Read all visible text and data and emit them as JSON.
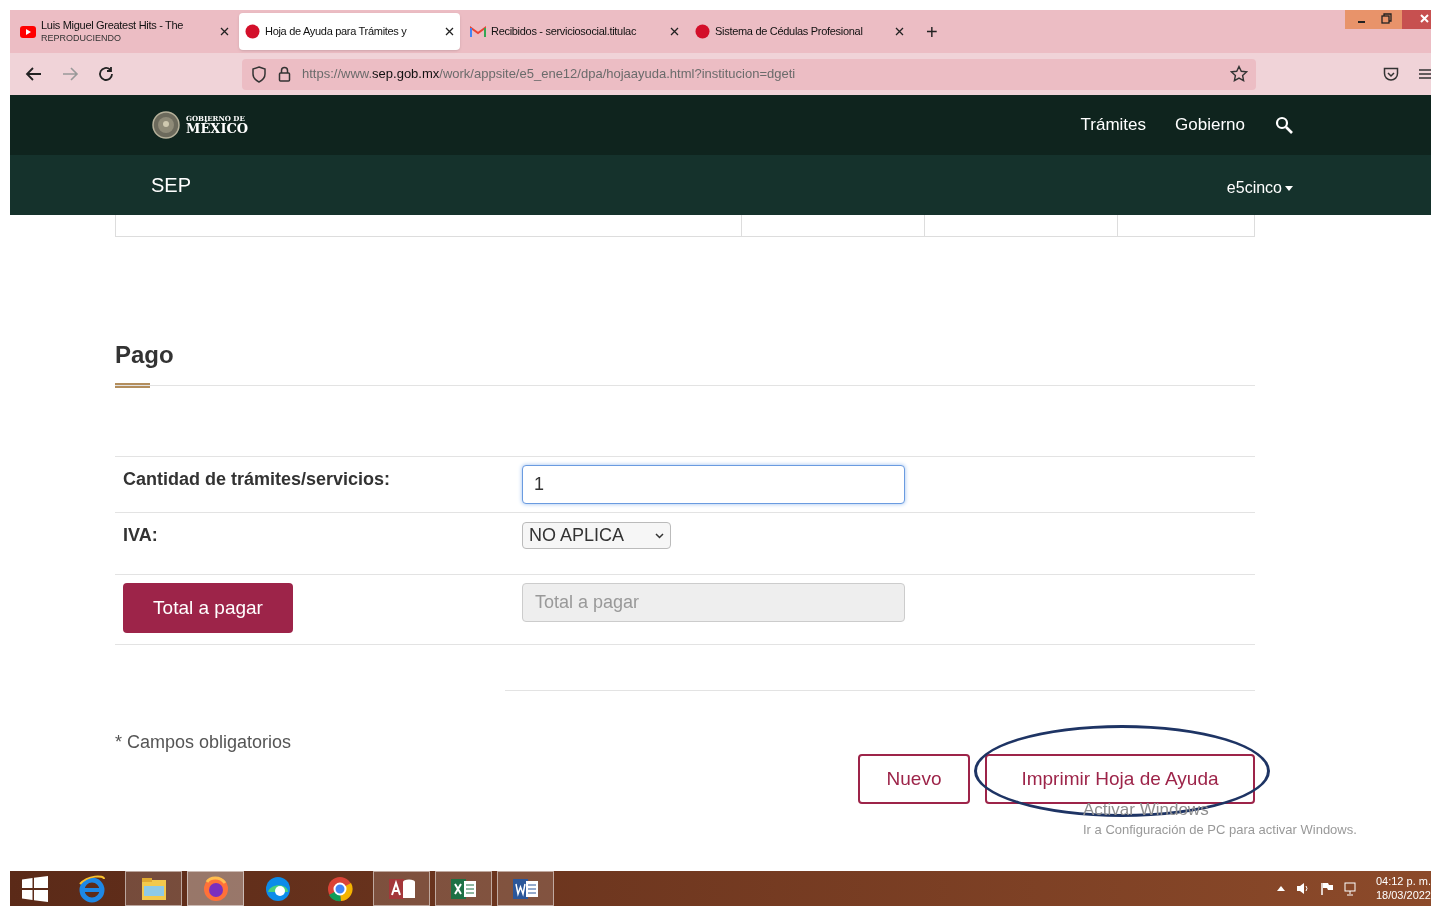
{
  "browser": {
    "tabs": [
      {
        "kind": "youtube",
        "title": "Luis Miguel Greatest Hits - The",
        "subtitle": "REPRODUCIENDO",
        "selected": false
      },
      {
        "kind": "dot",
        "title": "Hoja de Ayuda para Trámites y",
        "selected": true
      },
      {
        "kind": "gmail",
        "title": "Recibidos - serviciosocial.titulac",
        "selected": false
      },
      {
        "kind": "dot",
        "title": "Sistema de Cédulas Profesional",
        "selected": false
      }
    ],
    "new_tab": "+",
    "url": {
      "prefix": "https://www.",
      "domain": "sep.gob.mx",
      "path": "/work/appsite/e5_ene12/dpa/hojaayuda.html?institucion=dgeti"
    }
  },
  "header": {
    "logo_top": "GOBIERNO DE",
    "logo_bottom": "MÉXICO",
    "links": [
      "Trámites",
      "Gobierno"
    ],
    "section": "SEP",
    "menu": "e5cinco"
  },
  "section_title": "Pago",
  "form_rows": [
    {
      "kind": "input",
      "label": "Cantidad de trámites/servicios:",
      "value": "1",
      "focused": true
    },
    {
      "kind": "select",
      "label": "IVA:",
      "value": "NO APLICA"
    },
    {
      "kind": "action",
      "button": "Total a pagar",
      "placeholder": "Total a pagar",
      "disabled": true
    }
  ],
  "footnote": "* Campos obligatorios",
  "buttons": [
    {
      "label": "Nuevo",
      "circled": false
    },
    {
      "label": "Imprimir Hoja de Ayuda",
      "circled": true
    }
  ],
  "activation": {
    "title": "Activar Windows",
    "text": "Ir a Configuración de PC para activar Windows."
  },
  "taskbar": {
    "apps": [
      {
        "kind": "ie",
        "running": false,
        "selected": false
      },
      {
        "kind": "explorer",
        "running": true,
        "selected": false
      },
      {
        "kind": "firefox",
        "running": true,
        "selected": true
      },
      {
        "kind": "edge",
        "running": false,
        "selected": false
      },
      {
        "kind": "chrome",
        "running": false,
        "selected": false
      },
      {
        "kind": "access",
        "running": true,
        "selected": false
      },
      {
        "kind": "excel",
        "running": true,
        "selected": false
      },
      {
        "kind": "word",
        "running": true,
        "selected": false
      }
    ],
    "time": "04:12 p. m.",
    "date": "18/03/2022"
  }
}
